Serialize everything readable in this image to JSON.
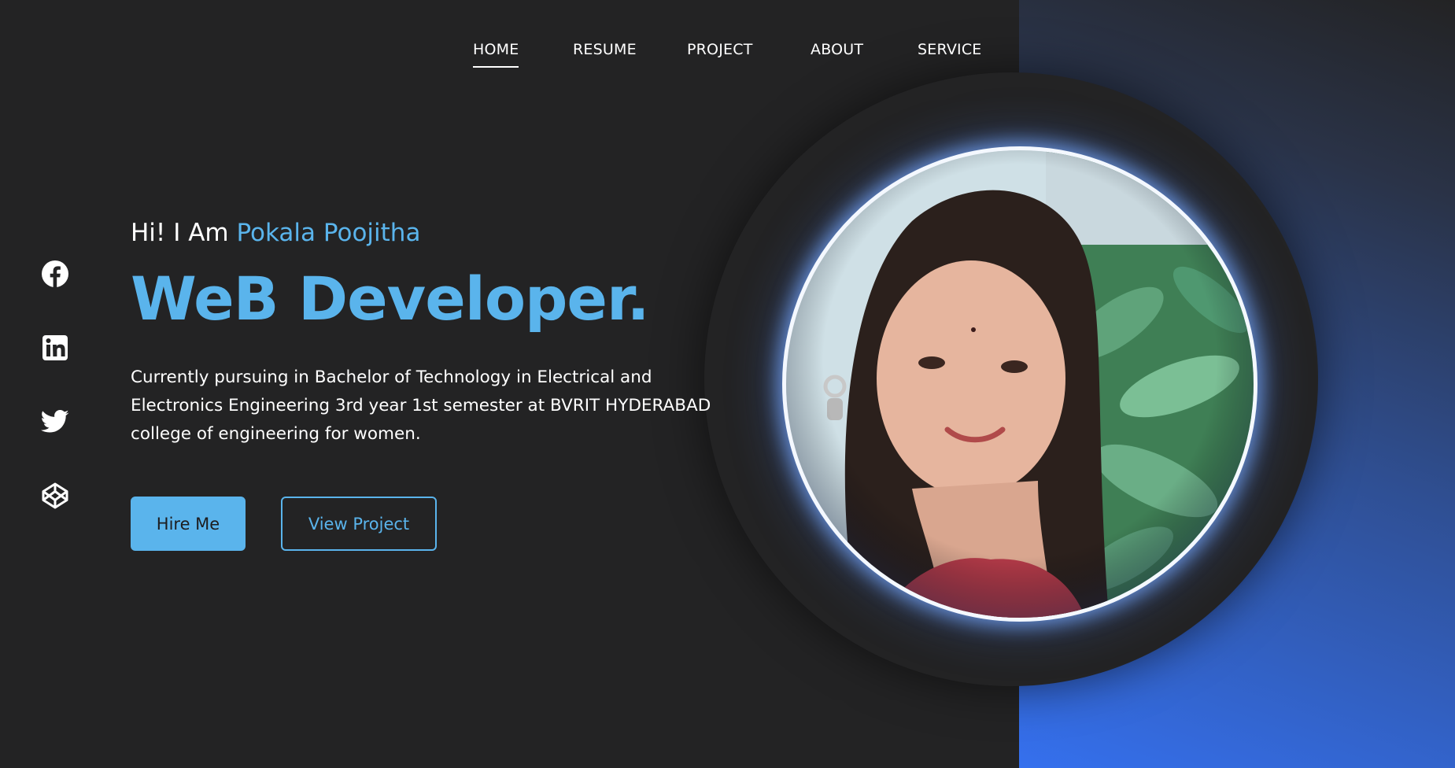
{
  "nav": {
    "items": [
      {
        "label": "HOME",
        "active": true
      },
      {
        "label": "RESUME",
        "active": false
      },
      {
        "label": "PROJECT",
        "active": false
      },
      {
        "label": "ABOUT",
        "active": false
      },
      {
        "label": "SERVICE",
        "active": false
      }
    ]
  },
  "social": {
    "icons": [
      "facebook-icon",
      "linkedin-icon",
      "twitter-icon",
      "codepen-icon"
    ]
  },
  "hero": {
    "greeting_prefix": "Hi! I Am ",
    "name": "Pokala Poojitha",
    "headline": "WeB Developer.",
    "bio": "Currently pursuing in Bachelor of Technology in Electrical and Electronics Engineering 3rd year 1st semester at BVRIT HYDERABAD college of engineering for women.",
    "hire_button": "Hire Me",
    "project_button": "View Project"
  },
  "colors": {
    "background": "#232324",
    "accent": "#5ab4ec",
    "gradient_end": "#3570ee"
  }
}
